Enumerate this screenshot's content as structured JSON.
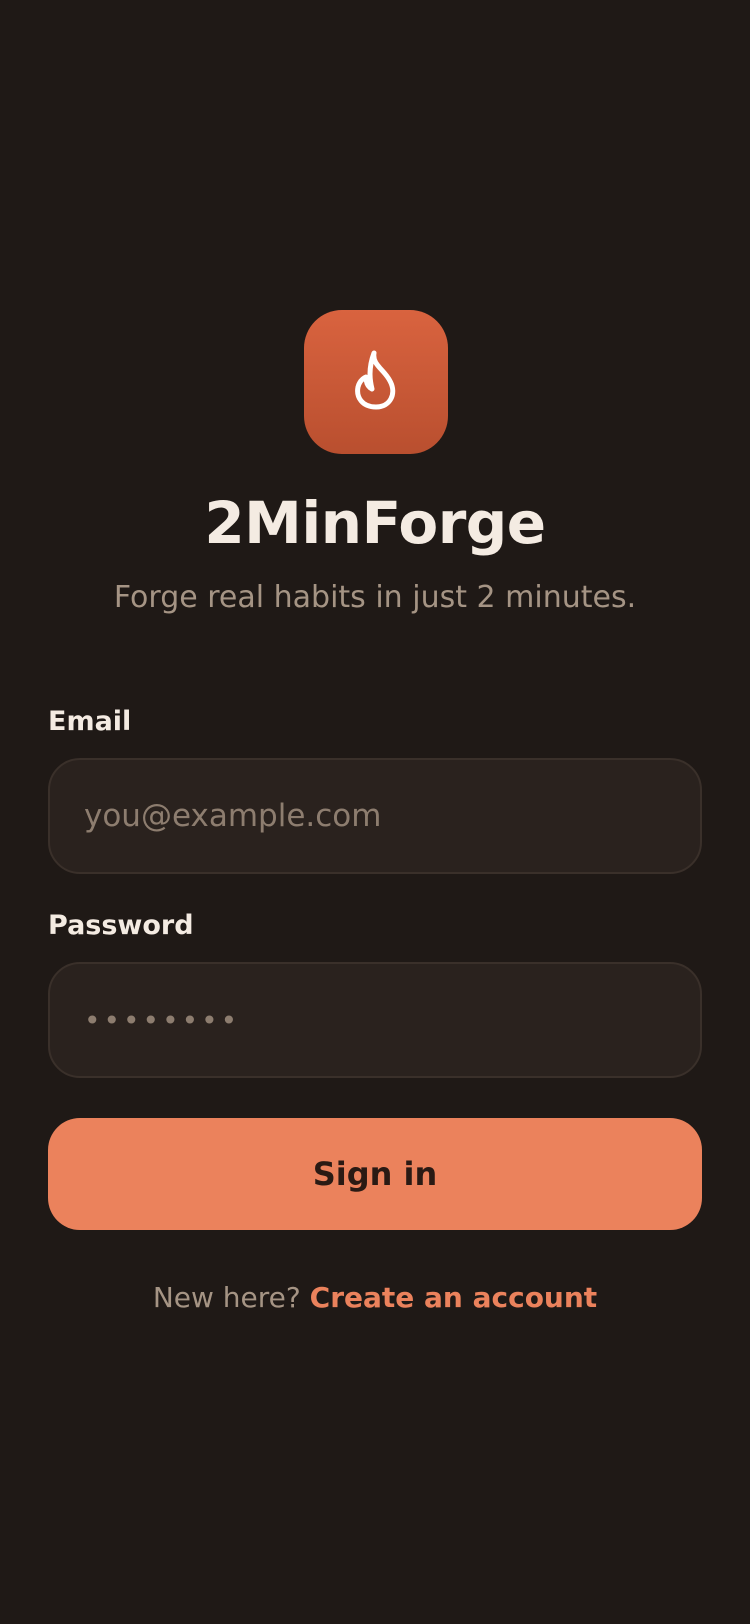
{
  "app": {
    "name": "2MinForge",
    "tagline": "Forge real habits in just 2 minutes.",
    "logo_icon": "flame-icon"
  },
  "form": {
    "email": {
      "label": "Email",
      "placeholder": "you@example.com",
      "value": ""
    },
    "password": {
      "label": "Password",
      "placeholder": "••••••••",
      "value": ""
    },
    "submit_label": "Sign in"
  },
  "signup": {
    "prompt": "New here?",
    "link_label": "Create an account"
  },
  "colors": {
    "background": "#1f1916",
    "accent": "#eb825c",
    "logo_tile": "#c85836",
    "input_background": "#2a221e",
    "text_primary": "#f4ebe2",
    "text_muted": "#a59484"
  }
}
